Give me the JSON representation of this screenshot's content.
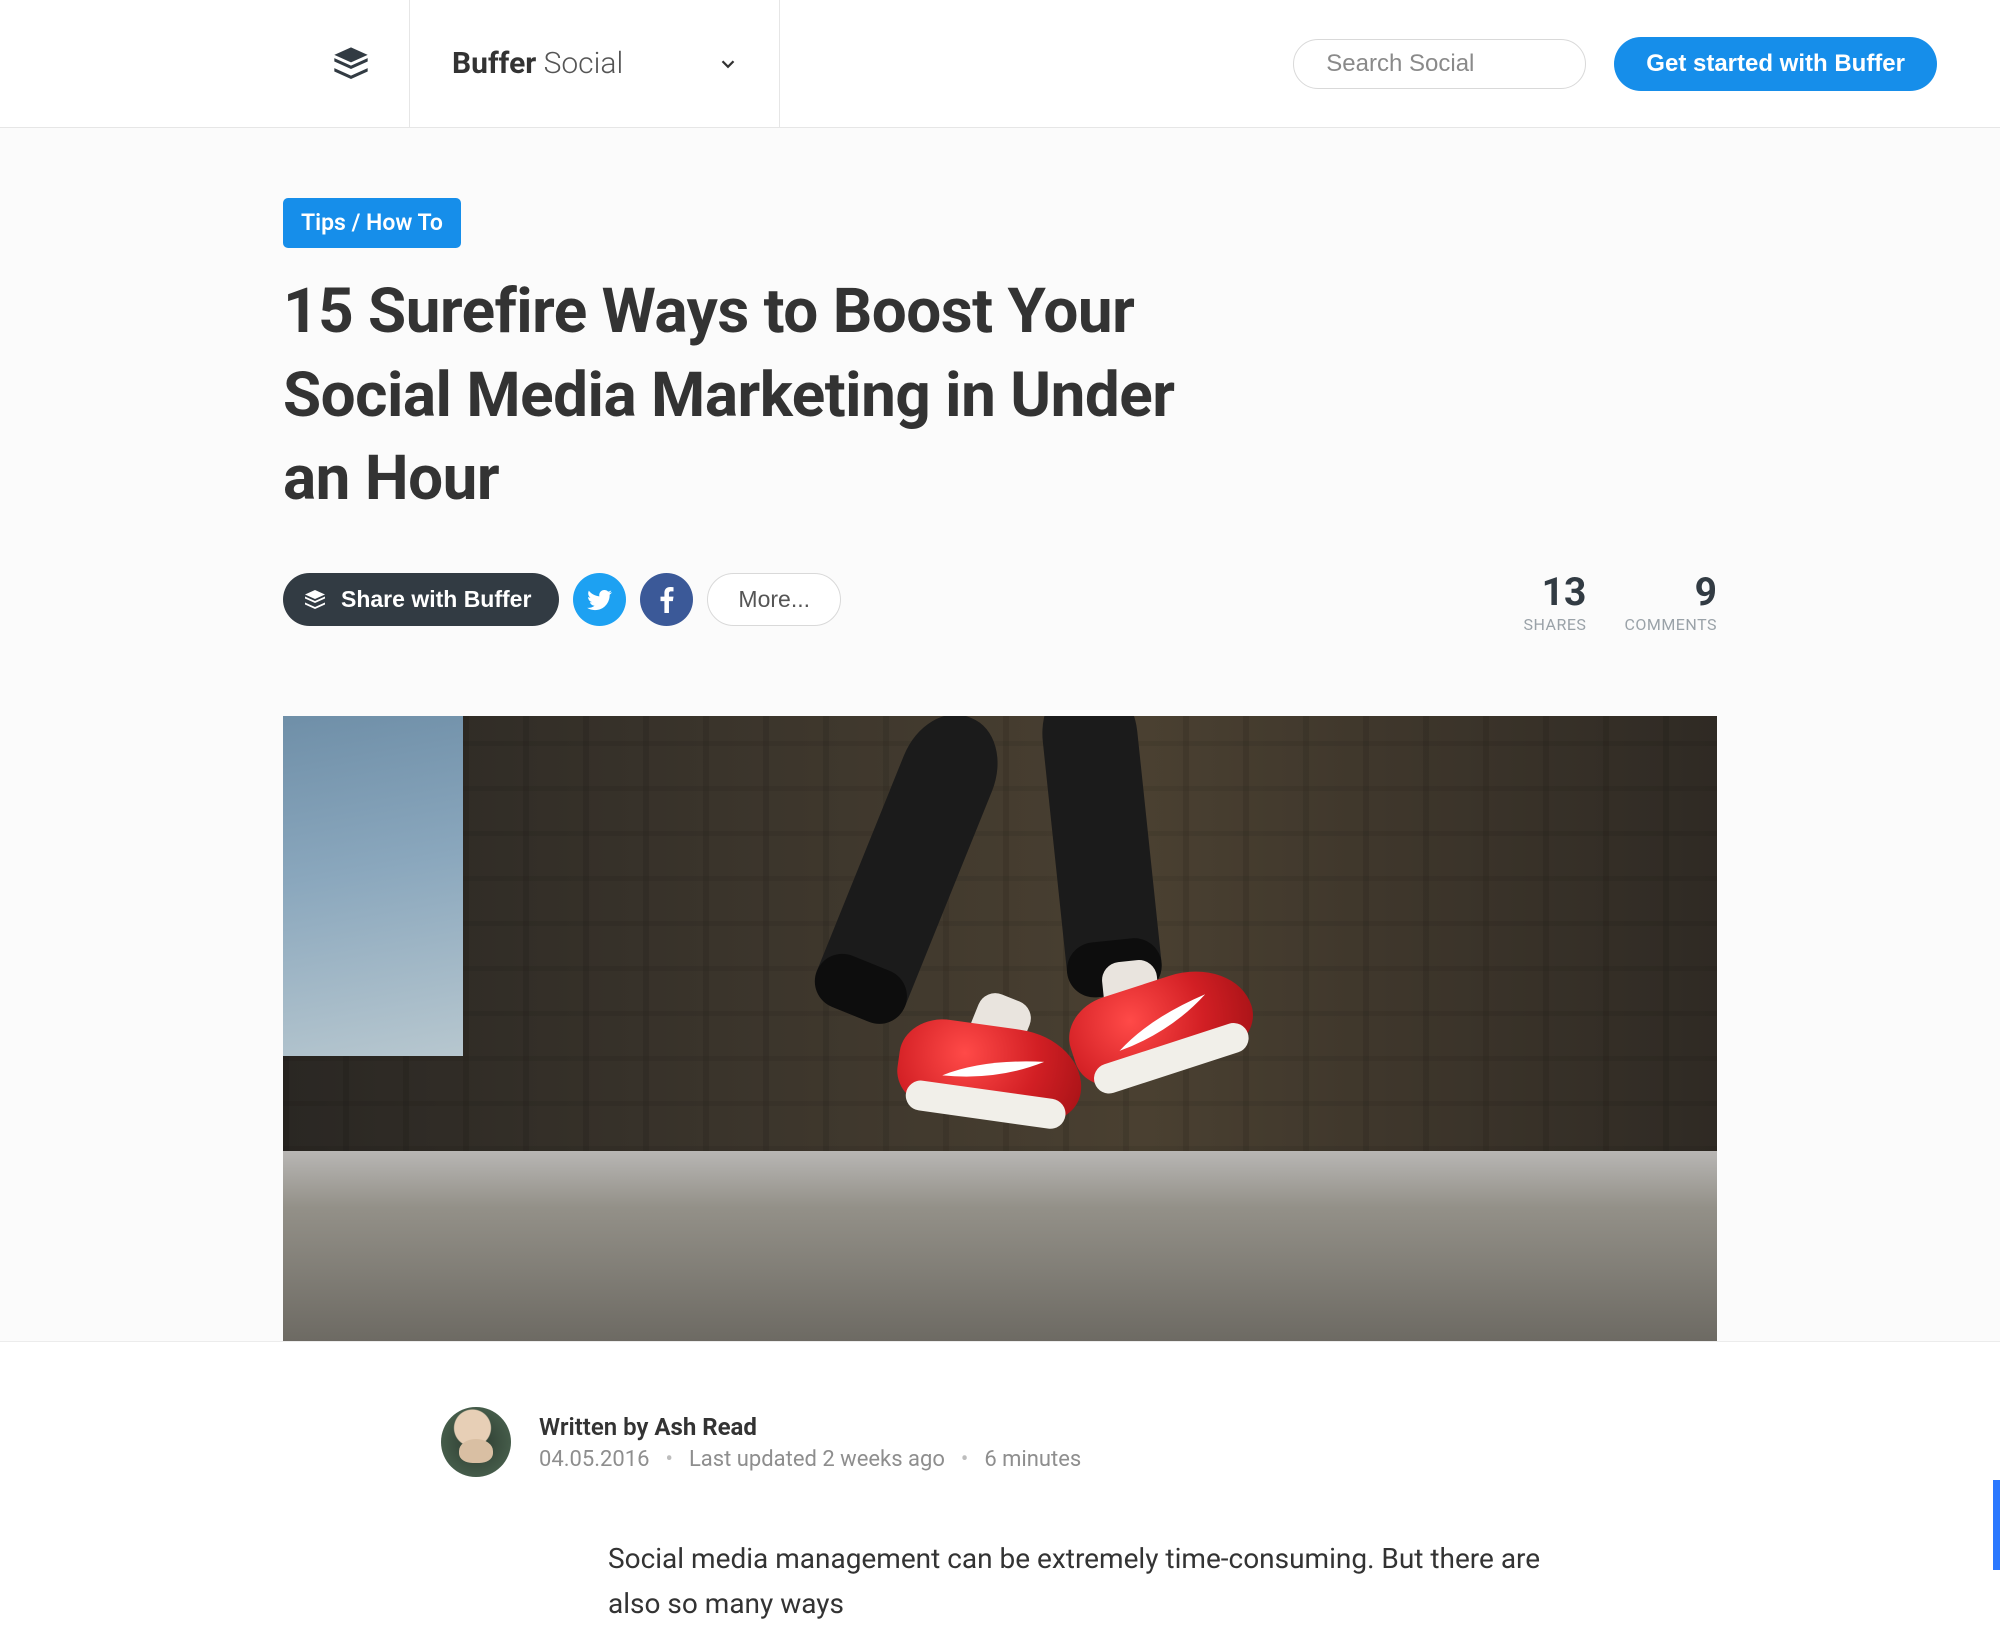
{
  "header": {
    "brand_bold": "Buffer",
    "brand_light": " Social",
    "search_placeholder": "Search Social",
    "cta_label": "Get started with Buffer"
  },
  "article": {
    "category": "Tips / How To",
    "title": "15 Surefire Ways to Boost Your Social Media Marketing in Under an Hour",
    "share_button": "Share with Buffer",
    "more_button": "More...",
    "shares_count": "13",
    "shares_label": "SHARES",
    "comments_count": "9",
    "comments_label": "COMMENTS"
  },
  "author": {
    "written_by": "Written by",
    "name": "Ash Read",
    "date": "04.05.2016",
    "updated": "Last updated 2 weeks ago",
    "read_time": "6 minutes"
  },
  "body": {
    "lead": "Social media management can be extremely time-consuming. But there are also so many ways"
  },
  "icons": {
    "buffer": "buffer-logo-icon",
    "chevron": "chevron-down-icon",
    "search": "search-icon",
    "twitter": "twitter-icon",
    "facebook": "facebook-icon"
  }
}
